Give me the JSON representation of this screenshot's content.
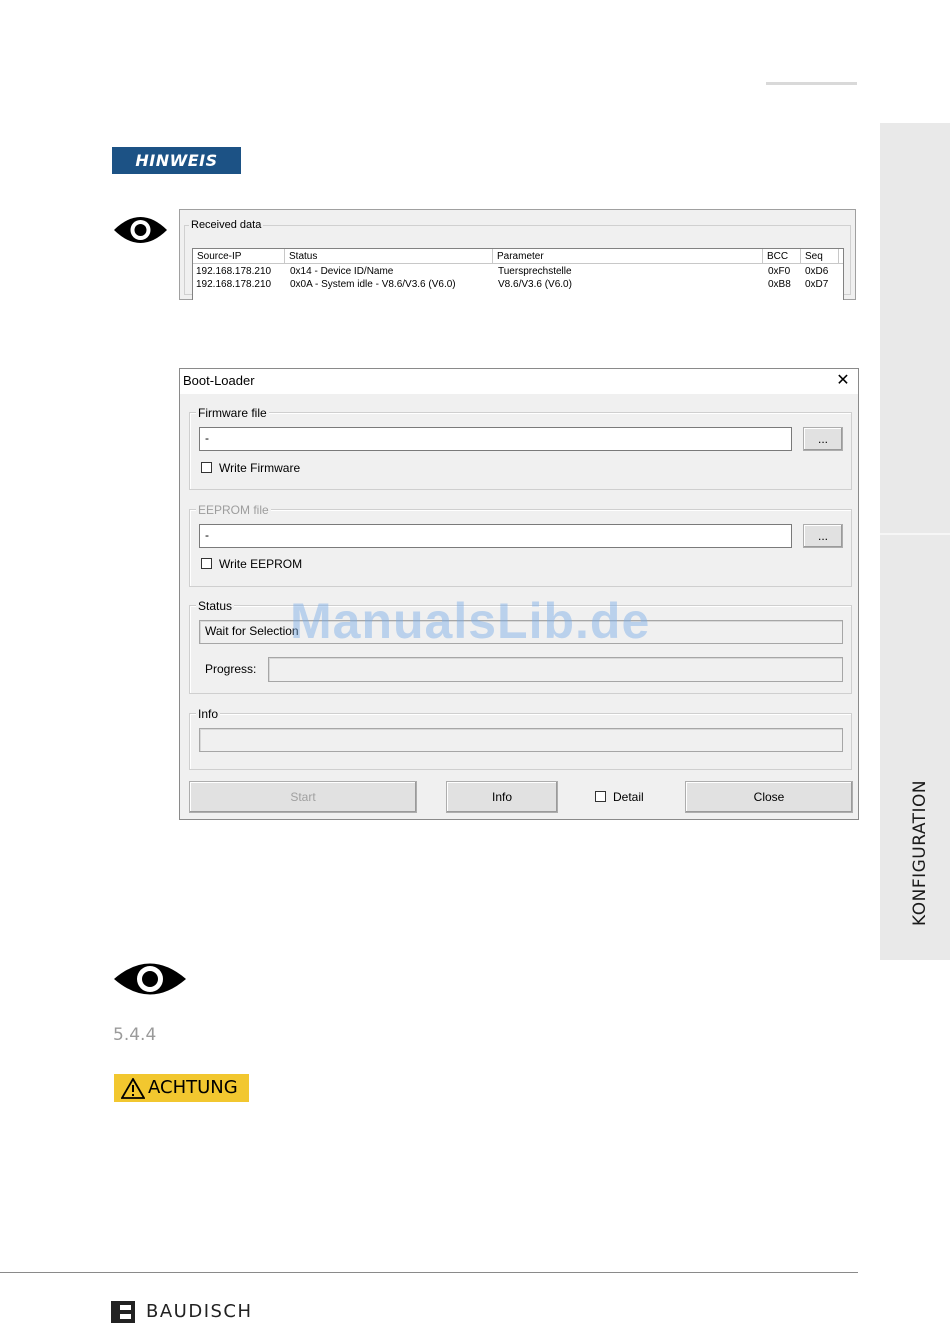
{
  "side_tab": {
    "label": "KONFIGURATION"
  },
  "notice": {
    "hinweis_label": "HINWEIS",
    "achtung_label": "ACHTUNG"
  },
  "icons": [
    "eye-icon",
    "eye-icon",
    "warning-triangle-icon",
    "baudisch-logo-icon",
    "close-icon"
  ],
  "received_data": {
    "legend": "Received data",
    "columns": [
      "Source-IP",
      "Status",
      "Parameter",
      "BCC",
      "Seq"
    ],
    "rows": [
      [
        "192.168.178.210",
        "0x14 - Device ID/Name",
        "Tuersprechstelle",
        "0xF0",
        "0xD6"
      ],
      [
        "192.168.178.210",
        "0x0A - System idle - V8.6/V3.6 (V6.0)",
        "V8.6/V3.6 (V6.0)",
        "0xB8",
        "0xD7"
      ]
    ]
  },
  "boot_loader": {
    "title": "Boot-Loader",
    "firmware": {
      "legend": "Firmware file",
      "value": "-",
      "browse_label": "...",
      "checkbox_label": "Write Firmware"
    },
    "eeprom": {
      "legend": "EEPROM file",
      "value": "-",
      "browse_label": "...",
      "checkbox_label": "Write EEPROM"
    },
    "status": {
      "legend": "Status",
      "value": "Wait for Selection",
      "progress_label": "Progress:"
    },
    "info": {
      "legend": "Info",
      "value": ""
    },
    "buttons": {
      "start": "Start",
      "info": "Info",
      "detail": "Detail",
      "close": "Close"
    }
  },
  "watermark": "ManualsLib.de",
  "section_number": "5.4.4",
  "footer": {
    "brand": "BAUDISCH"
  },
  "colors": {
    "hinweis_bg": "#1c5285",
    "achtung_bg": "#f2c72f",
    "side_tab_bg": "#e9e9e9"
  }
}
